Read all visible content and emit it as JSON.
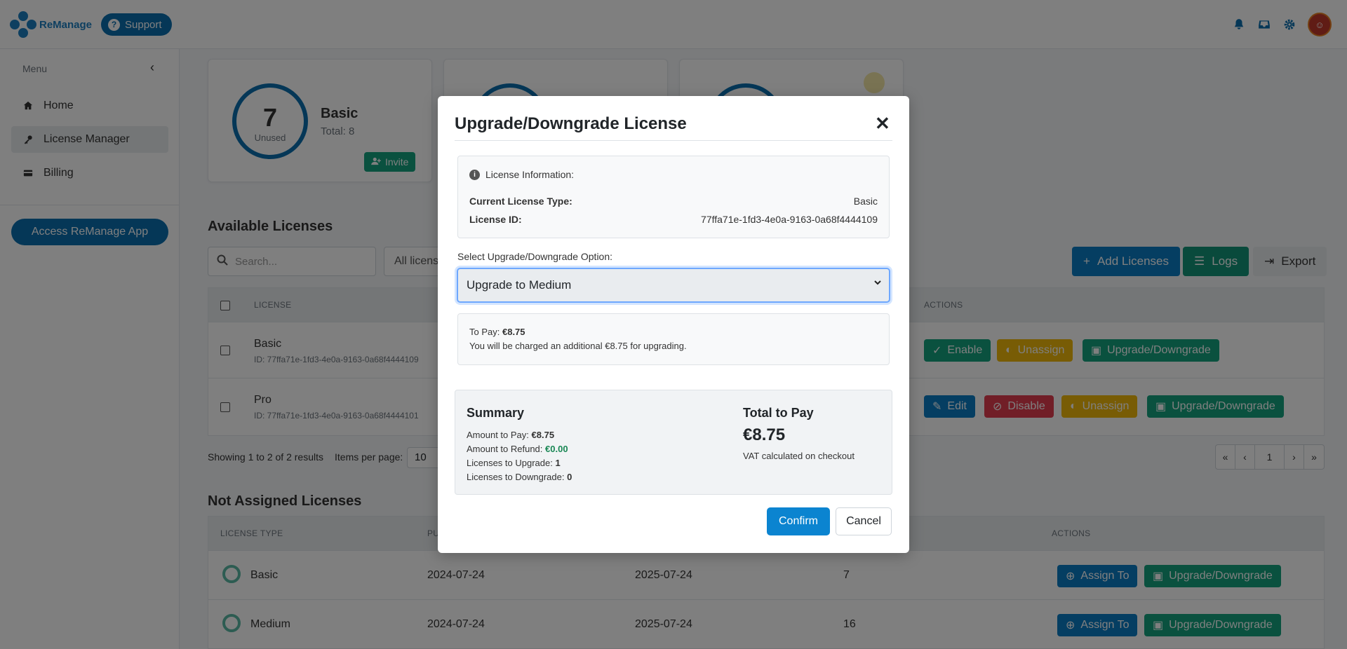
{
  "topbar": {
    "logo_text": "ReManage",
    "support_label": "Support"
  },
  "sidebar": {
    "menu_label": "Menu",
    "items": [
      {
        "label": "Home",
        "icon": "home-icon"
      },
      {
        "label": "License Manager",
        "icon": "key-icon"
      },
      {
        "label": "Billing",
        "icon": "credit-card-icon"
      }
    ],
    "access_button": "Access ReManage App"
  },
  "cards": [
    {
      "count": "7",
      "count_label": "Unused",
      "title": "Basic",
      "total": "Total: 8",
      "button": "Invite"
    }
  ],
  "available": {
    "title": "Available Licenses",
    "search_placeholder": "Search...",
    "filter_value": "All licenses",
    "add_button": "Add Licenses",
    "logs_button": "Logs",
    "export_button": "Export",
    "col_license": "LICENSE",
    "col_actions": "ACTIONS",
    "rows": [
      {
        "name": "Basic",
        "id": "ID: 77ffa71e-1fd3-4e0a-9163-0a68f4444109",
        "actions": [
          "Enable",
          "Unassign",
          "Upgrade/Downgrade"
        ]
      },
      {
        "name": "Pro",
        "id": "ID: 77ffa71e-1fd3-4e0a-9163-0a68f4444101",
        "actions": [
          "Edit",
          "Disable",
          "Unassign",
          "Upgrade/Downgrade"
        ]
      }
    ],
    "showing": "Showing 1 to 2 of 2 results",
    "items_per_page_label": "Items per page:",
    "items_per_page": "10",
    "page": "1"
  },
  "not_assigned": {
    "title": "Not Assigned Licenses",
    "col_type": "LICENSE TYPE",
    "col_purchased": "PU",
    "col_actions": "ACTIONS",
    "rows": [
      {
        "type": "Basic",
        "purchased": "2024-07-24",
        "expires": "2025-07-24",
        "count": "7",
        "assign": "Assign To",
        "upgrade": "Upgrade/Downgrade"
      },
      {
        "type": "Medium",
        "purchased": "2024-07-24",
        "expires": "2025-07-24",
        "count": "16",
        "assign": "Assign To",
        "upgrade": "Upgrade/Downgrade"
      }
    ]
  },
  "modal": {
    "title": "Upgrade/Downgrade License",
    "info_heading": "License Information:",
    "current_type_label": "Current License Type:",
    "current_type_value": "Basic",
    "license_id_label": "License ID:",
    "license_id_value": "77ffa71e-1fd3-4e0a-9163-0a68f4444109",
    "select_label": "Select Upgrade/Downgrade Option:",
    "select_value": "Upgrade to Medium",
    "to_pay_label": "To Pay:",
    "to_pay_value": "€8.75",
    "charge_note": "You will be charged an additional €8.75 for upgrading.",
    "summary_title": "Summary",
    "amount_to_pay_label": "Amount to Pay:",
    "amount_to_pay_value": "€8.75",
    "amount_to_refund_label": "Amount to Refund:",
    "amount_to_refund_value": "€0.00",
    "licenses_upgrade_label": "Licenses to Upgrade:",
    "licenses_upgrade_value": "1",
    "licenses_downgrade_label": "Licenses to Downgrade:",
    "licenses_downgrade_value": "0",
    "total_label": "Total to Pay",
    "total_value": "€8.75",
    "vat_note": "VAT calculated on checkout",
    "confirm": "Confirm",
    "cancel": "Cancel"
  },
  "colors": {
    "primary": "#0b6fae",
    "success": "#14a37f",
    "warning": "#f0b90b",
    "danger": "#e23d4f",
    "refund_green": "#198754"
  }
}
